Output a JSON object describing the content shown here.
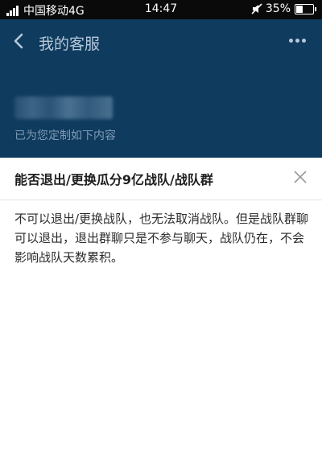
{
  "status_bar": {
    "carrier": "中国移动4G",
    "time": "14:47",
    "battery": "35%",
    "battery_level": 0.35,
    "icons": [
      "signal-icon",
      "mute-icon",
      "battery-icon"
    ]
  },
  "header": {
    "title": "我的客服",
    "subtitle": "已为您定制如下内容",
    "icons": [
      "back-icon",
      "more-icon"
    ]
  },
  "modal": {
    "title": "能否退出/更换瓜分9亿战队/战队群",
    "body": "不可以退出/更换战队，也无法取消战队。但是战队群聊可以退出，退出群聊只是不参与聊天，战队仍在，不会影响战队天数累积。",
    "icons": [
      "close-icon"
    ]
  },
  "colors": {
    "header_bg": "#0f3b5f",
    "modal_bg": "#ffffff",
    "title_text": "#1f1f1f",
    "body_text": "#2b2b2b"
  }
}
